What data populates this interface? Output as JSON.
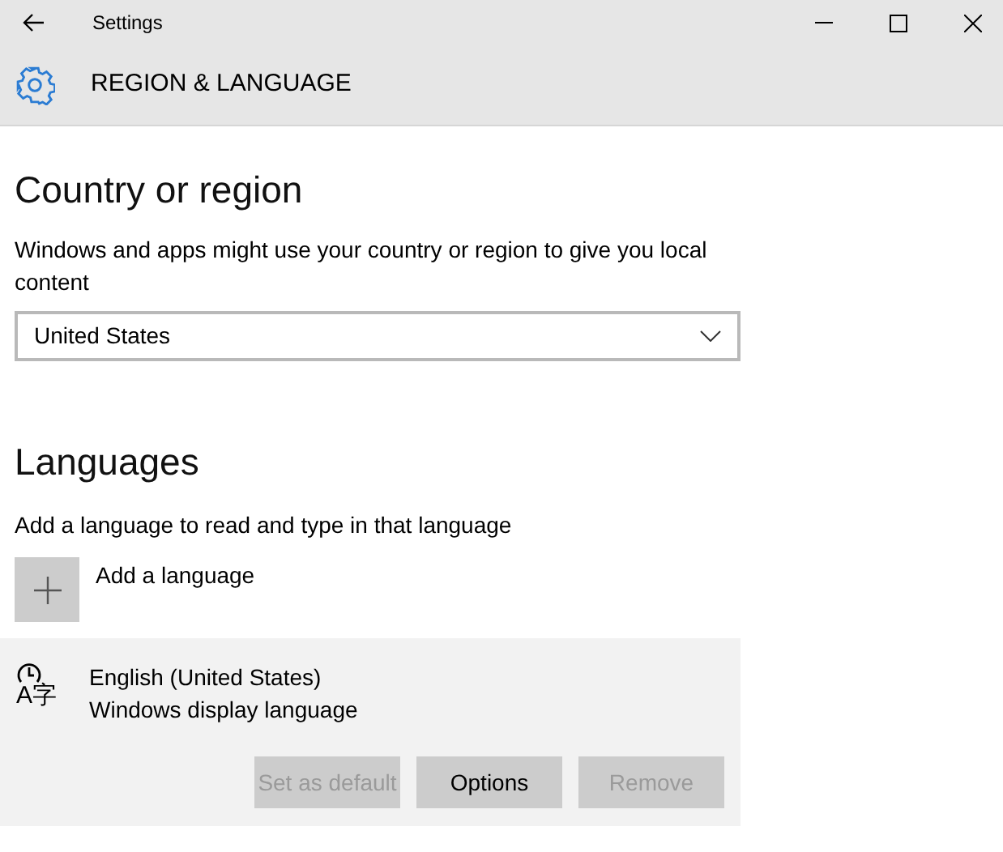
{
  "window": {
    "title": "Settings"
  },
  "header": {
    "title": "REGION & LANGUAGE"
  },
  "country": {
    "heading": "Country or region",
    "description": "Windows and apps might use your country or region to give you local content",
    "dropdown": {
      "value": "United States"
    }
  },
  "languages": {
    "heading": "Languages",
    "description": "Add a language to read and type in that language",
    "add_button": {
      "label": "Add a language"
    },
    "items": [
      {
        "icon_glyphs": "A字",
        "name": "English (United States)",
        "subtitle": "Windows display language",
        "selected": true,
        "buttons": [
          {
            "label": "Set as default",
            "disabled": true
          },
          {
            "label": "Options",
            "disabled": false
          },
          {
            "label": "Remove",
            "disabled": true
          }
        ]
      }
    ]
  }
}
